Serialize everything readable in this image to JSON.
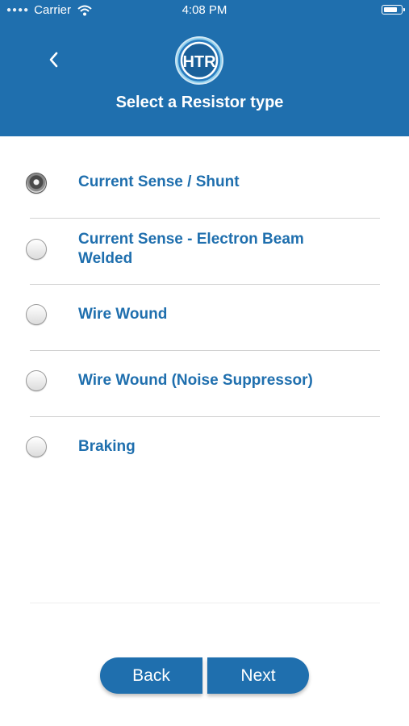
{
  "status_bar": {
    "carrier": "Carrier",
    "time": "4:08 PM"
  },
  "header": {
    "logo_text": "HTR",
    "title": "Select a Resistor type"
  },
  "options": [
    {
      "label": "Current Sense / Shunt",
      "selected": true
    },
    {
      "label": "Current Sense - Electron Beam Welded",
      "selected": false
    },
    {
      "label": "Wire Wound",
      "selected": false
    },
    {
      "label": "Wire Wound (Noise Suppressor)",
      "selected": false
    },
    {
      "label": "Braking",
      "selected": false
    }
  ],
  "footer": {
    "back_label": "Back",
    "next_label": "Next"
  },
  "colors": {
    "brand": "#1f6fae",
    "background": "#ffffff",
    "divider": "#d2d2d2"
  }
}
